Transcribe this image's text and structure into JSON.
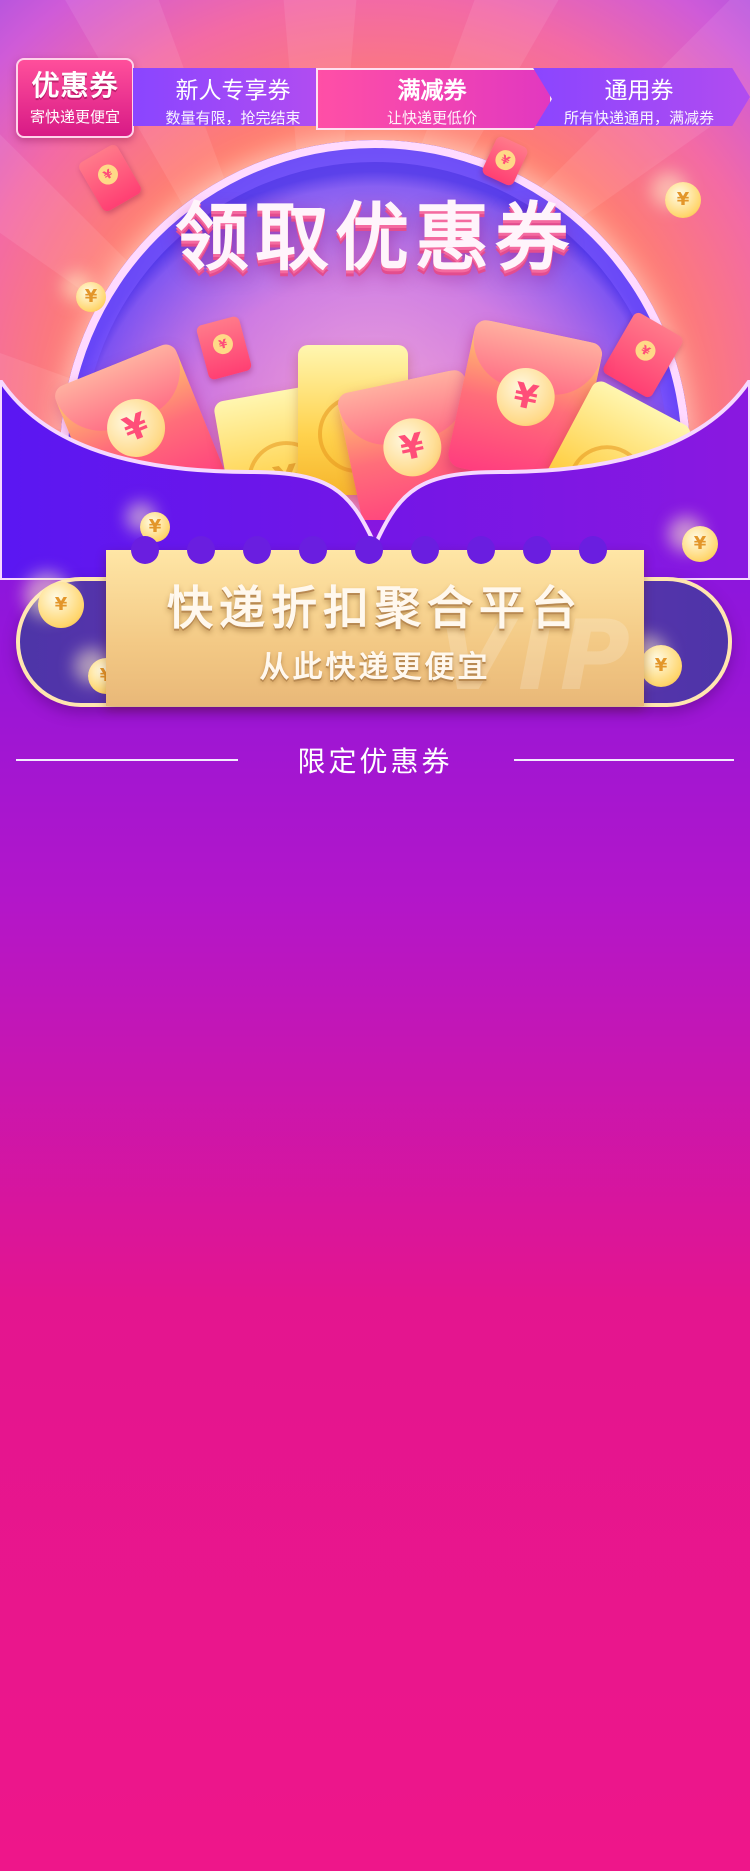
{
  "header": {
    "logo_title": "优惠券",
    "logo_sub": "寄快递更便宜",
    "tabs": [
      {
        "title": "新人专享券",
        "subtitle": "数量有限，抢完结束"
      },
      {
        "title": "满减券",
        "subtitle": "让快递更低价"
      },
      {
        "title": "通用券",
        "subtitle": "所有快递通用，满减券"
      }
    ],
    "active_tab": 1
  },
  "hero": {
    "title": "领取优惠券",
    "currency_symbol": "¥"
  },
  "banner": {
    "title": "快递折扣聚合平台",
    "subtitle": "从此快递更便宜",
    "watermark": "VIP"
  },
  "section": {
    "title": "限定优惠券"
  },
  "colors": {
    "accent_pink": "#ee168a",
    "accent_purple": "#5b17f2",
    "gold": "#f3c985"
  }
}
